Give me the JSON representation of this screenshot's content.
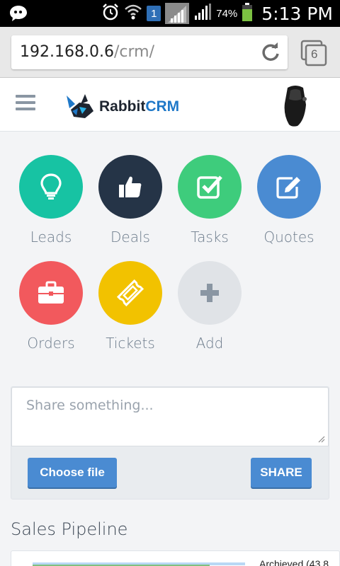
{
  "status_bar": {
    "time": "5:13 PM",
    "battery_percent": "74%",
    "sim_slot": "1"
  },
  "browser": {
    "url_host": "192.168.0.6",
    "url_path": "/crm/",
    "tab_count": "6"
  },
  "app": {
    "logo_part1": "Rabbit",
    "logo_part2": "CRM"
  },
  "modules": [
    {
      "label": "Leads",
      "icon": "lightbulb-icon",
      "color": "#17c3a3"
    },
    {
      "label": "Deals",
      "icon": "thumbs-up-icon",
      "color": "#253447"
    },
    {
      "label": "Tasks",
      "icon": "checkbox-icon",
      "color": "#3ecc7c"
    },
    {
      "label": "Quotes",
      "icon": "edit-icon",
      "color": "#4a8bd2"
    },
    {
      "label": "Orders",
      "icon": "briefcase-icon",
      "color": "#f2595d"
    },
    {
      "label": "Tickets",
      "icon": "ticket-icon",
      "color": "#f2c200"
    },
    {
      "label": "Add",
      "icon": "plus-icon",
      "color": "#e0e3e7"
    }
  ],
  "share": {
    "placeholder": "Share something...",
    "choose_file_label": "Choose file",
    "share_label": "SHARE"
  },
  "pipeline": {
    "title": "Sales Pipeline",
    "first_label": "Archieved (43.8"
  }
}
